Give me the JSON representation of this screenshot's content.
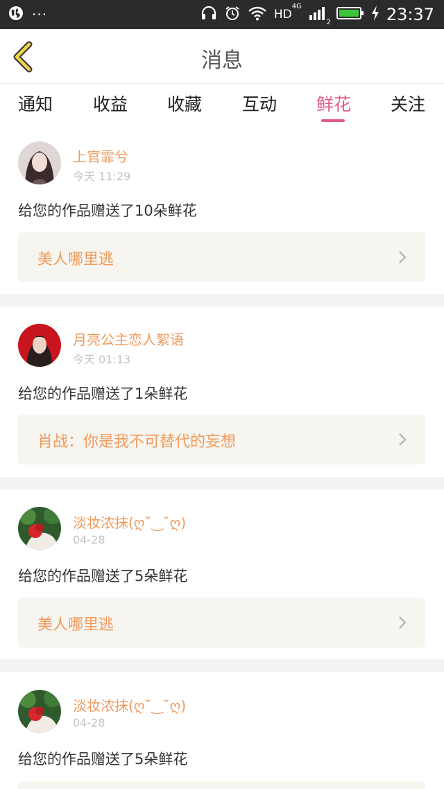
{
  "status_bar": {
    "dots": "···",
    "network": "HD",
    "network_sup": "4G",
    "sim": "2",
    "time": "23:37"
  },
  "header": {
    "title": "消息"
  },
  "tabs": [
    {
      "label": "通知",
      "active": false
    },
    {
      "label": "收益",
      "active": false
    },
    {
      "label": "收藏",
      "active": false
    },
    {
      "label": "互动",
      "active": false
    },
    {
      "label": "鲜花",
      "active": true
    },
    {
      "label": "关注",
      "active": false
    }
  ],
  "colors": {
    "accent": "#e05a8d",
    "username": "#f09a5c",
    "work_bg": "#f6f5ef",
    "status_bar": "#2b2b2b"
  },
  "messages": [
    {
      "username": "上官霏兮",
      "time": "今天 11:29",
      "text": "给您的作品赠送了10朵鲜花",
      "work": "美人哪里逃"
    },
    {
      "username": "月亮公主恋人絮语",
      "time": "今天 01:13",
      "text": "给您的作品赠送了1朵鲜花",
      "work": "肖战：你是我不可替代的妄想"
    },
    {
      "username": "淡妆浓抹(ღ˘‿˘ღ)",
      "time": "04-28",
      "text": "给您的作品赠送了5朵鲜花",
      "work": "美人哪里逃"
    },
    {
      "username": "淡妆浓抹(ღ˘‿˘ღ)",
      "time": "04-28",
      "text": "给您的作品赠送了5朵鲜花",
      "work": ""
    }
  ]
}
